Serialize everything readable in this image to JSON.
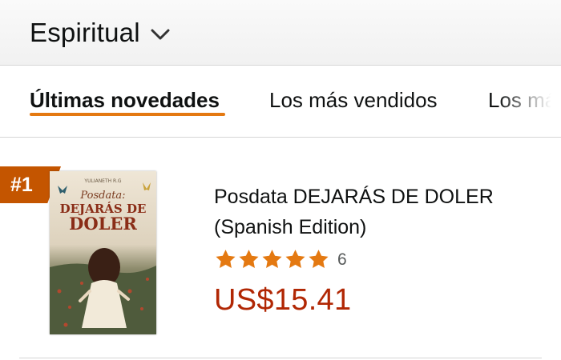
{
  "category": {
    "title": "Espiritual",
    "chevron_icon": "chevron-down-icon"
  },
  "tabs": [
    {
      "label": "Últimas novedades",
      "active": true
    },
    {
      "label": "Los más vendidos",
      "active": false
    },
    {
      "label": "Los más",
      "active": false
    }
  ],
  "product": {
    "rank": "#1",
    "cover": {
      "author": "YULIANETH R.G",
      "title_script": "Posdata:",
      "title_line1": "DEJARÁS DE",
      "title_line2": "DOLER"
    },
    "title": "Posdata DEJARÁS DE DOLER (Spanish Edition)",
    "rating_stars": 5,
    "rating_count": "6",
    "price": "US$15.41"
  },
  "colors": {
    "accent_underline": "#e47911",
    "rank_badge": "#c45500",
    "star": "#e47911",
    "price": "#b12704"
  }
}
